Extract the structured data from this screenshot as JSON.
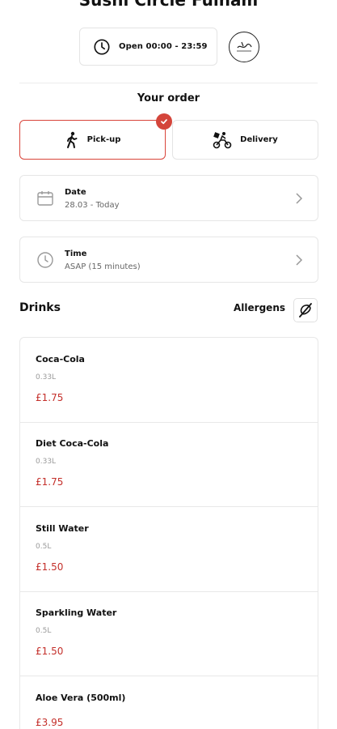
{
  "restaurant": {
    "name": "Sushi Circle Fulham"
  },
  "hours": {
    "label": "Open 00:00 - 23:59"
  },
  "order": {
    "heading": "Your order",
    "pickup_label": "Pick-up",
    "delivery_label": "Delivery",
    "selected_mode": "pickup",
    "date": {
      "label": "Date",
      "value": "28.03 - Today"
    },
    "time": {
      "label": "Time",
      "value": "ASAP (15 minutes)"
    }
  },
  "menu": {
    "section_title": "Drinks",
    "allergens_label": "Allergens",
    "items": [
      {
        "name": "Coca-Cola",
        "size": "0.33L",
        "price": "£1.75"
      },
      {
        "name": "Diet Coca-Cola",
        "size": "0.33L",
        "price": "£1.75"
      },
      {
        "name": "Still Water",
        "size": "0.5L",
        "price": "£1.50"
      },
      {
        "name": "Sparkling Water",
        "size": "0.5L",
        "price": "£1.50"
      },
      {
        "name": "Aloe Vera (500ml)",
        "size": "",
        "price": "£3.95"
      }
    ]
  },
  "colors": {
    "accent": "#d4453b",
    "price": "#c4302b",
    "border": "#e6e6e6"
  },
  "icons": [
    "clock-icon",
    "logo-icon",
    "walking-icon",
    "delivery-bike-icon",
    "check-icon",
    "calendar-icon",
    "chevron-right-icon",
    "allergen-filter-icon"
  ]
}
